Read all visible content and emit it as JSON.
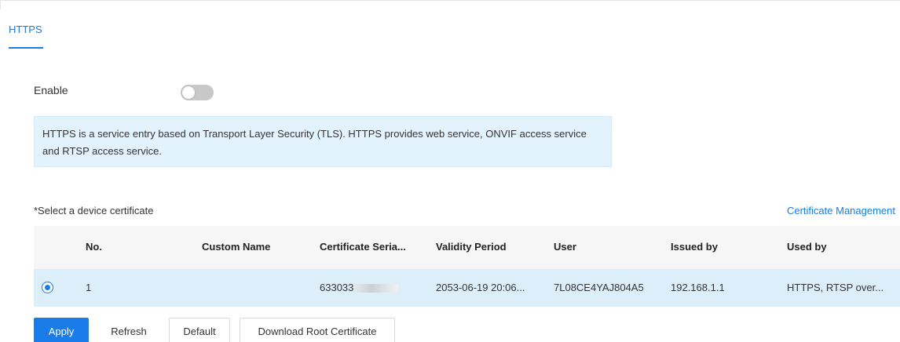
{
  "tabs": [
    {
      "label": "HTTPS"
    }
  ],
  "enable": {
    "label": "Enable",
    "on": false
  },
  "info": {
    "text": "HTTPS is a service entry based on Transport Layer Security (TLS). HTTPS provides web service, ONVIF access service and RTSP access service."
  },
  "certificate": {
    "label": "*Select a device certificate",
    "management_link": "Certificate Management"
  },
  "table": {
    "columns": [
      "No.",
      "Custom Name",
      "Certificate Seria...",
      "Validity Period",
      "User",
      "Issued by",
      "Used by"
    ],
    "rows": [
      {
        "selected": true,
        "no": "1",
        "custom_name": "",
        "serial": "633033",
        "validity": "2053-06-19 20:06...",
        "user": "7L08CE4YAJ804A5",
        "issued_by": "192.168.1.1",
        "used_by": "HTTPS, RTSP over..."
      }
    ]
  },
  "buttons": {
    "apply": "Apply",
    "refresh": "Refresh",
    "default": "Default",
    "download_root": "Download Root Certificate"
  },
  "colors": {
    "accent": "#1a7ce8",
    "info_bg": "#e3f3fd",
    "selected_row": "#ddeefb"
  }
}
